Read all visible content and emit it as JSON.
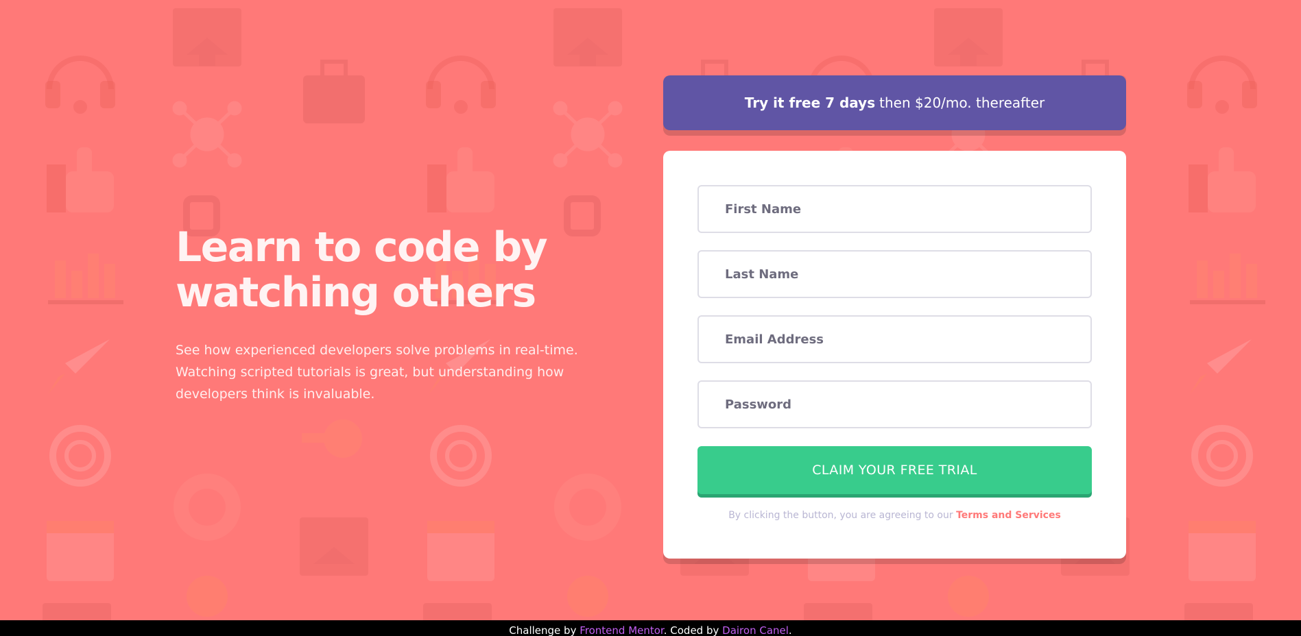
{
  "hero": {
    "title_line1": "Learn to code by",
    "title_line2": "watching others",
    "description": "See how experienced developers solve problems in real-time. Watching scripted tutorials is great, but understanding how developers think is invaluable."
  },
  "promo": {
    "bold": "Try it free 7 days",
    "rest": "then $20/mo. thereafter"
  },
  "form": {
    "first_name_placeholder": "First Name",
    "last_name_placeholder": "Last Name",
    "email_placeholder": "Email Address",
    "password_placeholder": "Password",
    "submit_label": "CLAIM YOUR FREE TRIAL",
    "terms_prefix": "By clicking the button, you are agreeing to our",
    "terms_link": "Terms and Services"
  },
  "footer": {
    "prefix": "Challenge by",
    "challenge_link": "Frontend Mentor",
    "middle": ". Coded by",
    "author_link": "Dairon Canel",
    "suffix": "."
  },
  "colors": {
    "background": "#ff7978",
    "promo": "#6055a5",
    "cta": "#38cc8c",
    "link": "#ff7978",
    "footer_link": "#c15ff0"
  },
  "background_icons": [
    "browser-home-icon",
    "toolbox-icon",
    "headset-icon",
    "network-icon",
    "thumbs-up-icon",
    "lock-icon",
    "chart-icon",
    "rocket-icon",
    "globe-gear-icon",
    "lifebuoy-icon",
    "calendar-icon",
    "lightbulb-icon",
    "key-icon",
    "shopping-cart-icon"
  ]
}
